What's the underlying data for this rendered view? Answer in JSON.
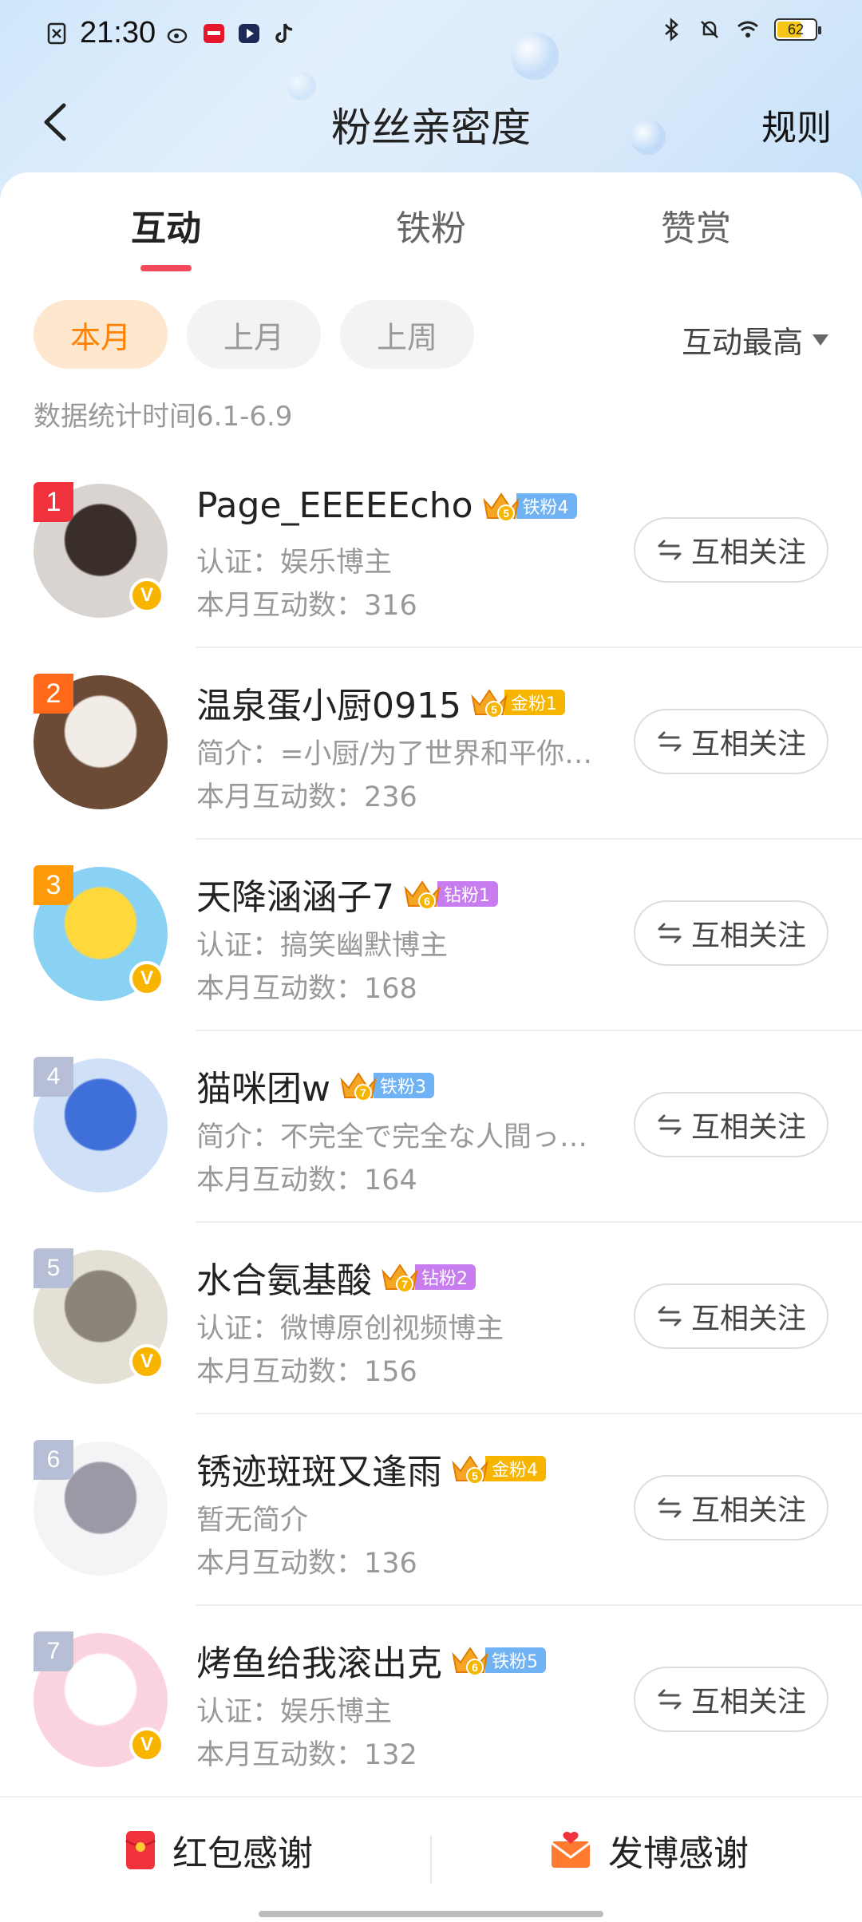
{
  "status_bar": {
    "time": "21:30",
    "battery": "62"
  },
  "nav": {
    "title": "粉丝亲密度",
    "rule": "规则"
  },
  "tabs": [
    {
      "label": "互动",
      "active": true
    },
    {
      "label": "铁粉",
      "active": false
    },
    {
      "label": "赞赏",
      "active": false
    }
  ],
  "filters": [
    {
      "label": "本月",
      "active": true
    },
    {
      "label": "上月",
      "active": false
    },
    {
      "label": "上周",
      "active": false
    }
  ],
  "sort": {
    "label": "互动最高"
  },
  "stat_time": "数据统计时间6.1-6.9",
  "follow_label": "互相关注",
  "fans": [
    {
      "rank": "1",
      "name": "Page_EEEEEcho",
      "crown_level": "5",
      "fan_badge": "铁粉4",
      "badge_color": "#6fb3f5",
      "desc": "认证：娱乐博主",
      "count": "本月互动数：316",
      "verified": true,
      "avatar_colors": [
        "#d9d4cf",
        "#3a2e2b"
      ]
    },
    {
      "rank": "2",
      "name": "温泉蛋小厨0915",
      "crown_level": "5",
      "fan_badge": "金粉1",
      "badge_color": "#f7b500",
      "desc": "简介：=小厨/为了世界和平你…",
      "count": "本月互动数：236",
      "verified": false,
      "avatar_colors": [
        "#6b4a36",
        "#f2ece6"
      ]
    },
    {
      "rank": "3",
      "name": "天降涵涵子7",
      "crown_level": "6",
      "fan_badge": "钻粉1",
      "badge_color": "#c77cf0",
      "desc": "认证：搞笑幽默博主",
      "count": "本月互动数：168",
      "verified": true,
      "avatar_colors": [
        "#8ad2f3",
        "#ffd93b"
      ]
    },
    {
      "rank": "4",
      "name": "猫咪团w",
      "crown_level": "7",
      "fan_badge": "铁粉3",
      "badge_color": "#6fb3f5",
      "desc": "简介：不完全で完全な人間っ…",
      "count": "本月互动数：164",
      "verified": false,
      "avatar_colors": [
        "#cfe0f7",
        "#3f6fd8"
      ]
    },
    {
      "rank": "5",
      "name": "水合氨基酸",
      "crown_level": "7",
      "fan_badge": "钻粉2",
      "badge_color": "#c77cf0",
      "desc": "认证：微博原创视频博主",
      "count": "本月互动数：156",
      "verified": true,
      "avatar_colors": [
        "#e4e0d6",
        "#8b8478"
      ]
    },
    {
      "rank": "6",
      "name": "锈迹斑斑又逢雨",
      "crown_level": "5",
      "fan_badge": "金粉4",
      "badge_color": "#f7b500",
      "desc": "暂无简介",
      "count": "本月互动数：136",
      "verified": false,
      "avatar_colors": [
        "#f4f4f6",
        "#9a9aa6"
      ]
    },
    {
      "rank": "7",
      "name": "烤鱼给我滚出克",
      "crown_level": "6",
      "fan_badge": "铁粉5",
      "badge_color": "#6fb3f5",
      "desc": "认证：娱乐博主",
      "count": "本月互动数：132",
      "verified": true,
      "avatar_colors": [
        "#fbd3df",
        "#ffffff"
      ]
    }
  ],
  "bottom": {
    "left_label": "红包感谢",
    "right_label": "发博感谢"
  }
}
